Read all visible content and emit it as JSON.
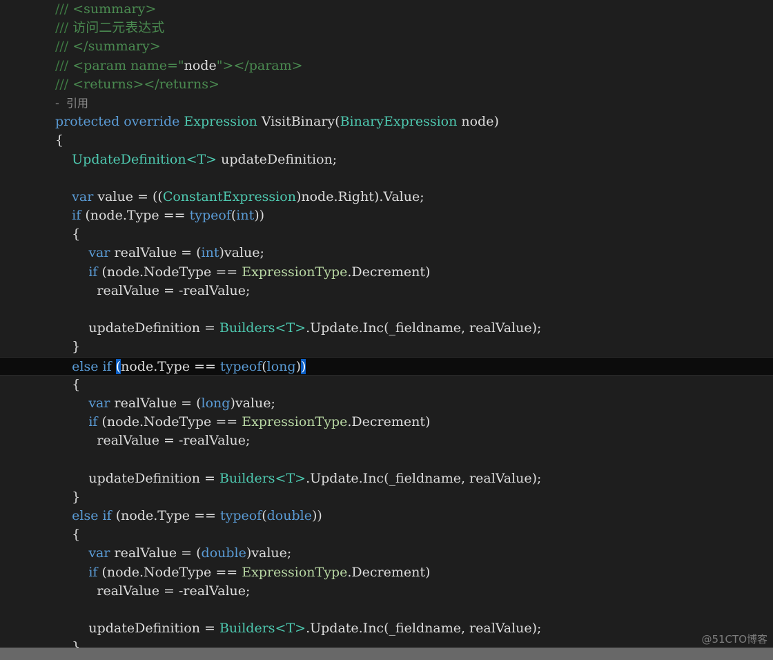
{
  "editor": {
    "background_color": "#1e1e1e",
    "current_line_color": "#0c0c0c",
    "bracket_match_color": "#0b5ec4",
    "watermark": "@51CTO博客",
    "codelens": "-  引用"
  },
  "code": {
    "l01": {
      "c1": "/// ",
      "c2": "<summary>"
    },
    "l02": {
      "c1": "/// ",
      "c2": "访问二元表达式"
    },
    "l03": {
      "c1": "/// ",
      "c2": "</summary>"
    },
    "l04": {
      "c1": "/// ",
      "c2": "<param name=\"",
      "c3": "node",
      "c4": "\"></param>"
    },
    "l05": {
      "c1": "/// ",
      "c2": "<returns></returns>"
    },
    "l06": {
      "c1": "-  引用"
    },
    "l07": {
      "kw1": "protected",
      "kw2": "override",
      "t1": "Expression",
      "n1": "VisitBinary",
      "p1": "(",
      "t2": "BinaryExpression",
      "n2": " node",
      "p2": ")"
    },
    "l08": {
      "t": "{"
    },
    "l09": {
      "t1": "UpdateDefinition",
      "t2": "<T>",
      "n1": " updateDefinition;"
    },
    "l10": {
      "t": ""
    },
    "l11": {
      "kw": "var",
      "n1": " value = ((",
      "t1": "ConstantExpression",
      "n2": ")node.Right).Value;"
    },
    "l12": {
      "kw1": "if",
      "n1": " (node.Type == ",
      "kw2": "typeof",
      "n2": "(",
      "kw3": "int",
      "n3": "))"
    },
    "l13": {
      "t": "{"
    },
    "l14": {
      "kw1": "var",
      "n1": " realValue = (",
      "kw2": "int",
      "n2": ")value;"
    },
    "l15": {
      "kw1": "if",
      "n1": " (node.NodeType == ",
      "e1": "ExpressionType",
      "n2": ".Decrement)"
    },
    "l16": {
      "n1": "realValue = -realValue;"
    },
    "l17": {
      "t": ""
    },
    "l18": {
      "n1": "updateDefinition = ",
      "t1": "Builders",
      "t2": "<T>",
      "n2": ".Update.Inc(_fieldname, realValue);"
    },
    "l19": {
      "t": "}"
    },
    "l20": {
      "kw1": "else",
      "kw2": "if",
      "b1": "(",
      "n1": "node.Type == ",
      "kw3": "typeof",
      "n2": "(",
      "kw4": "long",
      "n3": ")",
      "b2": ")"
    },
    "l21": {
      "t": "{"
    },
    "l22": {
      "kw1": "var",
      "n1": " realValue = (",
      "kw2": "long",
      "n2": ")value;"
    },
    "l23": {
      "kw1": "if",
      "n1": " (node.NodeType == ",
      "e1": "ExpressionType",
      "n2": ".Decrement)"
    },
    "l24": {
      "n1": "realValue = -realValue;"
    },
    "l25": {
      "t": ""
    },
    "l26": {
      "n1": "updateDefinition = ",
      "t1": "Builders",
      "t2": "<T>",
      "n2": ".Update.Inc(_fieldname, realValue);"
    },
    "l27": {
      "t": "}"
    },
    "l28": {
      "kw1": "else",
      "kw2": "if",
      "n1": " (node.Type == ",
      "kw3": "typeof",
      "n2": "(",
      "kw4": "double",
      "n3": "))"
    },
    "l29": {
      "t": "{"
    },
    "l30": {
      "kw1": "var",
      "n1": " realValue = (",
      "kw2": "double",
      "n2": ")value;"
    },
    "l31": {
      "kw1": "if",
      "n1": " (node.NodeType == ",
      "e1": "ExpressionType",
      "n2": ".Decrement)"
    },
    "l32": {
      "n1": "realValue = -realValue;"
    },
    "l33": {
      "t": ""
    },
    "l34": {
      "n1": "updateDefinition = ",
      "t1": "Builders",
      "t2": "<T>",
      "n2": ".Update.Inc(_fieldname, realValue);"
    },
    "l35": {
      "t": "}"
    }
  }
}
